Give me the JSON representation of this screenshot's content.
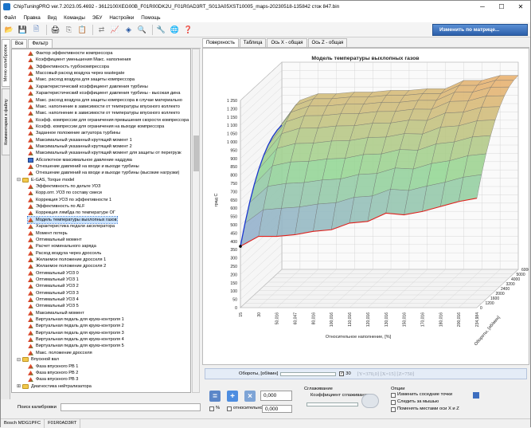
{
  "window": {
    "title": "ChipTuningPRO ver.7.2023.05.4692 - 3612100XEG00B_F01R00DK2U_F01R0AD3RT_S013A05XST10005_maps-20230518-135842 сток 847.bin"
  },
  "menu": [
    "Файл",
    "Правка",
    "Вид",
    "Команды",
    "ЭБУ",
    "Настройки",
    "Помощь"
  ],
  "toolbar": {
    "matrix_label": "Изменить по матрице..."
  },
  "side_tabs": [
    "Меню калибровок",
    "Комментарии к файлу"
  ],
  "left_tabs": [
    "Все",
    "Фильтр"
  ],
  "tree": [
    {
      "t": "Фактор эффективности компрессора",
      "i": "red",
      "lv": 2
    },
    {
      "t": "Коэффициент уменьшения Макс. наполнения",
      "i": "red",
      "lv": 2
    },
    {
      "t": "Эффективность турбокомпрессора",
      "i": "red",
      "lv": 2
    },
    {
      "t": "Массовый расход воздуха через wastegate",
      "i": "red",
      "lv": 2
    },
    {
      "t": "Макс. расход воздуха для защиты компрессора",
      "i": "red",
      "lv": 2
    },
    {
      "t": "Характеристический коэффициент давления турбины",
      "i": "red",
      "lv": 2
    },
    {
      "t": "Характеристический коэффициент давления турбины - высокая дина",
      "i": "red",
      "lv": 2
    },
    {
      "t": "Макс. расход воздуха для защиты компрессора в случае материально",
      "i": "red",
      "lv": 2
    },
    {
      "t": "Макс. наполнение в зависимости от температуры впускного коллекто",
      "i": "red",
      "lv": 2
    },
    {
      "t": "Макс. наполнение в зависимости от температуры впускного коллекто",
      "i": "red",
      "lv": 2
    },
    {
      "t": "Коэфф. компрессии для ограничения превышения скорости компрессора",
      "i": "red",
      "lv": 2
    },
    {
      "t": "Коэфф. компрессии для ограничения на выходе компрессора",
      "i": "red",
      "lv": 2
    },
    {
      "t": "Заданное положение актуатора турбины",
      "i": "red",
      "lv": 2
    },
    {
      "t": "Максимальный указанный крутящий момент 1",
      "i": "red",
      "lv": 2
    },
    {
      "t": "Максимальный указанный крутящий момент 2",
      "i": "red",
      "lv": 2
    },
    {
      "t": "Максимальный указанный крутящий момент для защиты от перегрузк",
      "i": "red",
      "lv": 2
    },
    {
      "t": "Абсолютное максимальное давление наддува",
      "i": "blue",
      "lv": 2
    },
    {
      "t": "Отношение давлений на входе и выходе турбины",
      "i": "red",
      "lv": 2
    },
    {
      "t": "Отношение давлений на входе и выходе турбины (высокие нагрузки)",
      "i": "red",
      "lv": 2
    },
    {
      "t": "E-GAS, Torque model",
      "i": "folder",
      "lv": 1,
      "exp": "minus"
    },
    {
      "t": "Эффективность по дельте УОЗ",
      "i": "red",
      "lv": 2
    },
    {
      "t": "Корр.опт. УОЗ по составу смеси",
      "i": "red",
      "lv": 2
    },
    {
      "t": "Коррекция УОЗ по эффективности 1",
      "i": "red",
      "lv": 2
    },
    {
      "t": "Эффективность по ALF",
      "i": "red",
      "lv": 2
    },
    {
      "t": "Коррекция лямбда по температуре ОГ",
      "i": "red",
      "lv": 2
    },
    {
      "t": "Модель температуры выхлопных газов",
      "i": "red",
      "lv": 2,
      "sel": true
    },
    {
      "t": "Характеристика педали акселератора",
      "i": "red",
      "lv": 2
    },
    {
      "t": "Момент потерь",
      "i": "red",
      "lv": 2
    },
    {
      "t": "Оптимальный момент",
      "i": "red",
      "lv": 2
    },
    {
      "t": "Расчет номинального заряда",
      "i": "red",
      "lv": 2
    },
    {
      "t": "Расход воздуха через дроссель",
      "i": "red",
      "lv": 2
    },
    {
      "t": "Желаемое положение дросселя 1",
      "i": "red",
      "lv": 2
    },
    {
      "t": "Желаемое положение дросселя 2",
      "i": "red",
      "lv": 2
    },
    {
      "t": "Оптимальный УОЗ 0",
      "i": "red",
      "lv": 2
    },
    {
      "t": "Оптимальный УОЗ 1",
      "i": "red",
      "lv": 2
    },
    {
      "t": "Оптимальный УОЗ 2",
      "i": "red",
      "lv": 2
    },
    {
      "t": "Оптимальный УОЗ 3",
      "i": "red",
      "lv": 2
    },
    {
      "t": "Оптимальный УОЗ 4",
      "i": "red",
      "lv": 2
    },
    {
      "t": "Оптимальный УОЗ 5",
      "i": "red",
      "lv": 2
    },
    {
      "t": "Максимальный момент",
      "i": "red",
      "lv": 2
    },
    {
      "t": "Виртуальная педаль для круиз-контроля 1",
      "i": "red",
      "lv": 2
    },
    {
      "t": "Виртуальная педаль для круиз-контроля 2",
      "i": "red",
      "lv": 2
    },
    {
      "t": "Виртуальная педаль для круиз-контроля 3",
      "i": "red",
      "lv": 2
    },
    {
      "t": "Виртуальная педаль для круиз-контроля 4",
      "i": "red",
      "lv": 2
    },
    {
      "t": "Виртуальная педаль для круиз-контроля 5",
      "i": "red",
      "lv": 2
    },
    {
      "t": "Макс. положение дросселя",
      "i": "red",
      "lv": 2
    },
    {
      "t": "Впускной вал",
      "i": "folder",
      "lv": 1,
      "exp": "minus"
    },
    {
      "t": "Фаза впускного РВ 1",
      "i": "red",
      "lv": 2
    },
    {
      "t": "Фаза впускного РВ 2",
      "i": "red",
      "lv": 2
    },
    {
      "t": "Фаза впускного РВ 3",
      "i": "red",
      "lv": 2
    },
    {
      "t": "Диагностика нейтрализатора",
      "i": "folder",
      "lv": 1,
      "exp": "plus"
    }
  ],
  "search": {
    "label": "Поиск калибровки"
  },
  "status": [
    "Bosch MDG1PFC",
    "F01R0AD3RT"
  ],
  "right_tabs": [
    "Поверхность",
    "Таблица",
    "Ось X - общая",
    "Ось Z - общая"
  ],
  "chart_data": {
    "type": "surface3d",
    "title": "Модель температуры выхлопных газов",
    "ylabel": "град С",
    "xlabel": "Относительное наполнение, [%]",
    "zlabel": "Обороты, [об/мин]",
    "y_ticks": [
      "1 250",
      "1 200",
      "1 150",
      "1 100",
      "1 050",
      "1 000",
      "950",
      "900",
      "850",
      "800",
      "750",
      "700",
      "650",
      "600",
      "550",
      "500",
      "450",
      "400",
      "350",
      "300",
      "250",
      "200",
      "150",
      "100",
      "50",
      "0"
    ],
    "x_ticks": [
      "15",
      "30",
      "50,016",
      "60,047",
      "80,016",
      "100,016",
      "110,016",
      "120,016",
      "130,016",
      "150,016",
      "170,016",
      "180,016",
      "200,016",
      "234,984"
    ],
    "z_ticks": [
      "0",
      "1200",
      "1600",
      "2000",
      "2400",
      "3200",
      "4000",
      "5000",
      "6000"
    ],
    "ylim": [
      0,
      1250
    ],
    "front_red": [
      370,
      430,
      430,
      440,
      460,
      470,
      510,
      520,
      570,
      560,
      580,
      610,
      640,
      660
    ],
    "back_edge": [
      870,
      1020,
      1060,
      1060,
      1070,
      1070,
      1080,
      1080,
      1090,
      1090,
      1140,
      1140,
      1170,
      1170
    ]
  },
  "x_slider": {
    "label": "Обороты, [об/мин]",
    "check_value": "30",
    "readout": "[Y=370,0]  [X=15]  [Z=750]"
  },
  "bottom": {
    "value1": "0,000",
    "value2": "0,000",
    "percent_label": "%",
    "relative_label": "относительно",
    "smoothing_title": "Сглаживание",
    "smoothing_coef": "Коэффициент сглаживания",
    "options_title": "Опции",
    "opt1": "Изменить соседние точки",
    "opt2": "Следить за мышью",
    "opt3": "Поменять местами оси X и Z"
  }
}
